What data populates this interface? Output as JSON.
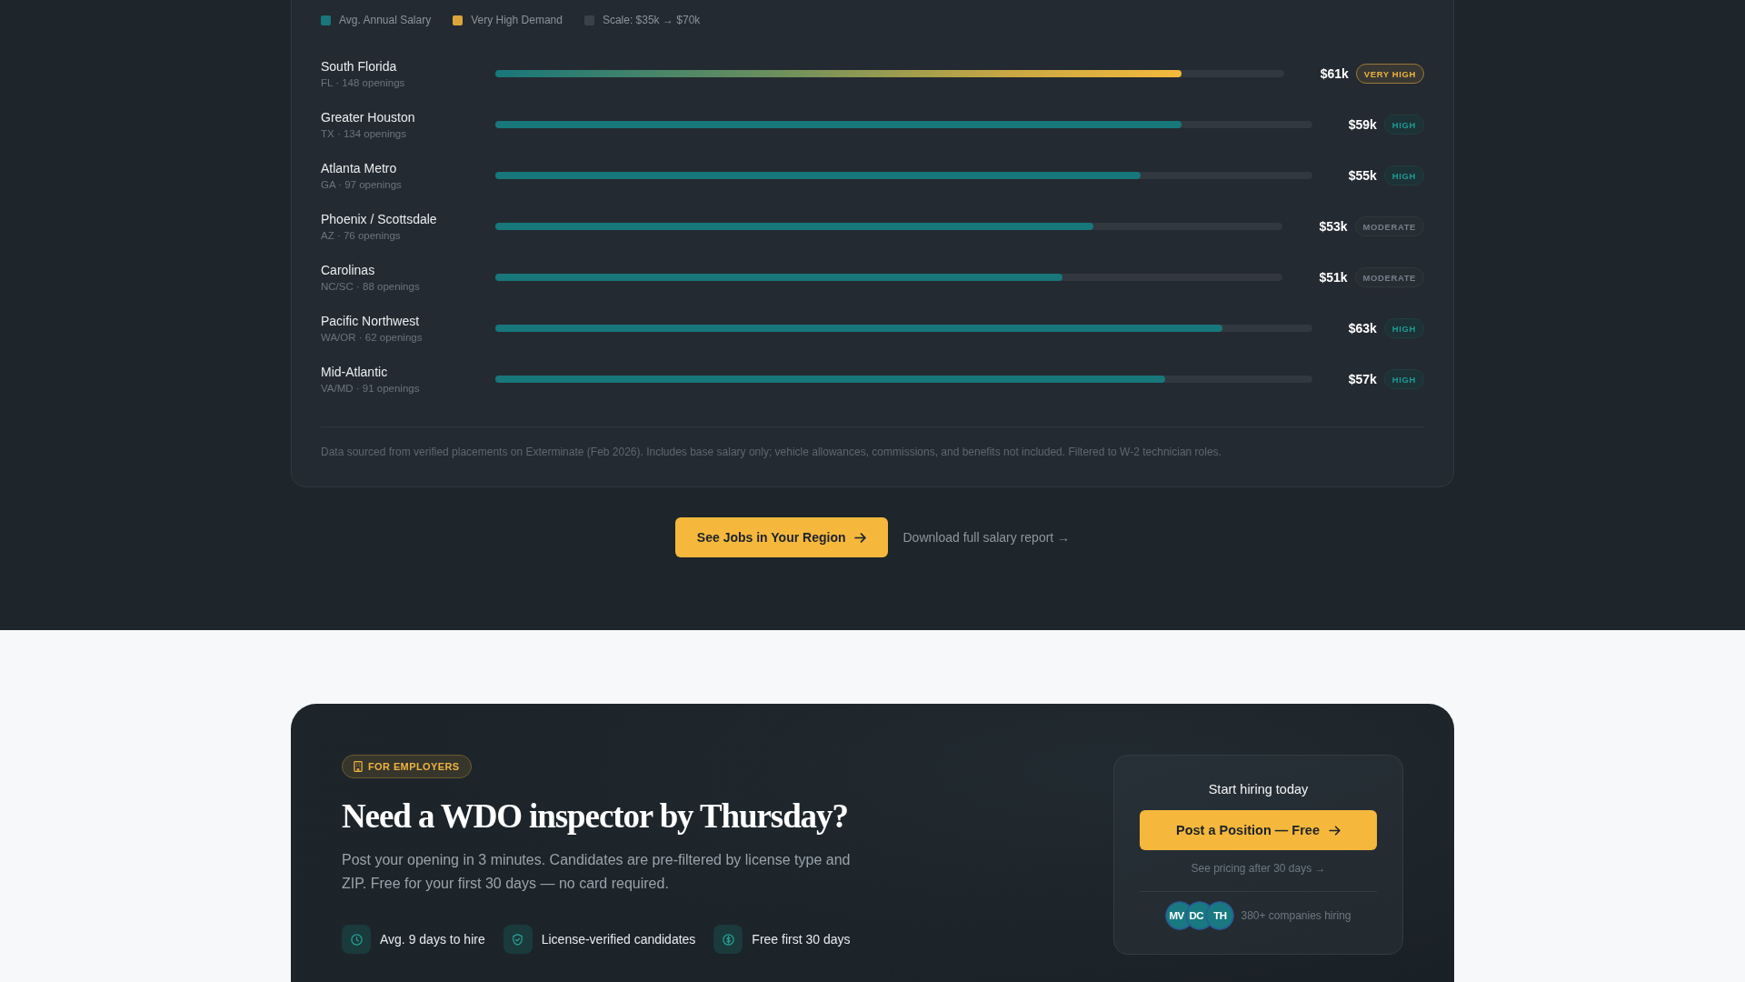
{
  "salary_chart": {
    "legend": [
      {
        "label": "Avg. Annual Salary",
        "color": "#17777a"
      },
      {
        "label": "Very High Demand",
        "color": "#dba53c"
      },
      {
        "label": "Scale: $35k → $70k",
        "color": "#3a4249"
      }
    ],
    "regions": [
      {
        "name": "South Florida",
        "details": "FL · 148 openings",
        "level": 0.87,
        "salary": "$61k",
        "kind": "peak",
        "tag": "VERY HIGH"
      },
      {
        "name": "Greater Houston",
        "details": "TX · 134 openings",
        "level": 0.84,
        "salary": "$59k",
        "kind": "high",
        "tag": "HIGH"
      },
      {
        "name": "Atlanta Metro",
        "details": "GA · 97 openings",
        "level": 0.79,
        "salary": "$55k",
        "kind": "high",
        "tag": "HIGH"
      },
      {
        "name": "Phoenix / Scottsdale",
        "details": "AZ · 76 openings",
        "level": 0.76,
        "salary": "$53k",
        "kind": "moderate",
        "tag": "MODERATE"
      },
      {
        "name": "Carolinas",
        "details": "NC/SC · 88 openings",
        "level": 0.72,
        "salary": "$51k",
        "kind": "moderate",
        "tag": "MODERATE"
      },
      {
        "name": "Pacific Northwest",
        "details": "WA/OR · 62 openings",
        "level": 0.89,
        "salary": "$63k",
        "kind": "high",
        "tag": "HIGH"
      },
      {
        "name": "Mid-Atlantic",
        "details": "VA/MD · 91 openings",
        "level": 0.82,
        "salary": "$57k",
        "kind": "high",
        "tag": "HIGH"
      }
    ],
    "footnote": "Data sourced from verified placements on Exterminate (Feb 2026). Includes base salary only; vehicle allowances, commissions, and benefits not included. Filtered to W-2 technician roles."
  },
  "actions": {
    "primary_button": "See Jobs in Your Region",
    "report_link": "Download full salary report →"
  },
  "employers": {
    "tag": "FOR EMPLOYERS",
    "heading": "Need a WDO inspector by Thursday?",
    "description": "Post your opening in 3 minutes. Candidates are pre-filtered by license type and ZIP. Free for your first 30 days — no card required.",
    "features": [
      {
        "kind": "speed",
        "label": "Avg. 9 days to hire"
      },
      {
        "kind": "verified",
        "label": "License-verified candidates"
      },
      {
        "kind": "free",
        "label": "Free first 30 days"
      }
    ],
    "hiring_card": {
      "title": "Start hiring today",
      "button": "Post a Position — Free",
      "pricing_link": "See pricing after 30 days →",
      "avatars": [
        "MV",
        "DC",
        "TH"
      ],
      "companies": "380+ companies hiring"
    }
  }
}
